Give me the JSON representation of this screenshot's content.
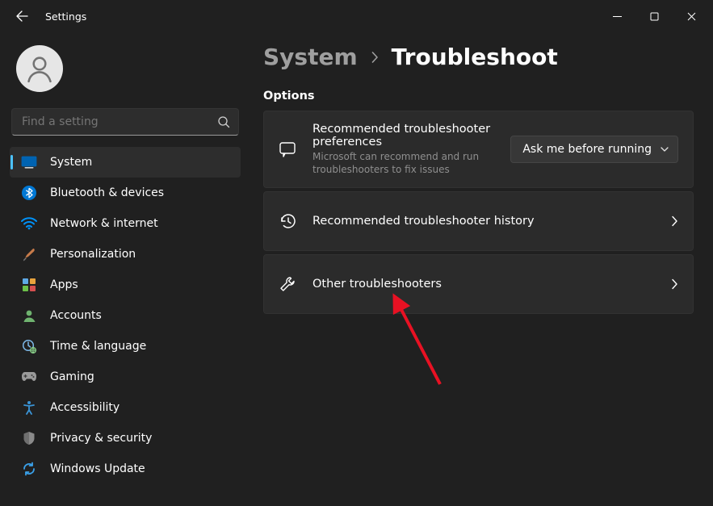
{
  "window": {
    "title": "Settings"
  },
  "search": {
    "placeholder": "Find a setting"
  },
  "sidebar": {
    "items": [
      {
        "label": "System"
      },
      {
        "label": "Bluetooth & devices"
      },
      {
        "label": "Network & internet"
      },
      {
        "label": "Personalization"
      },
      {
        "label": "Apps"
      },
      {
        "label": "Accounts"
      },
      {
        "label": "Time & language"
      },
      {
        "label": "Gaming"
      },
      {
        "label": "Accessibility"
      },
      {
        "label": "Privacy & security"
      },
      {
        "label": "Windows Update"
      }
    ]
  },
  "breadcrumb": {
    "parent": "System",
    "current": "Troubleshoot"
  },
  "sections": {
    "options_label": "Options"
  },
  "cards": {
    "prefs": {
      "title": "Recommended troubleshooter preferences",
      "subtitle": "Microsoft can recommend and run troubleshooters to fix issues",
      "dropdown_value": "Ask me before running"
    },
    "history": {
      "title": "Recommended troubleshooter history"
    },
    "other": {
      "title": "Other troubleshooters"
    }
  }
}
